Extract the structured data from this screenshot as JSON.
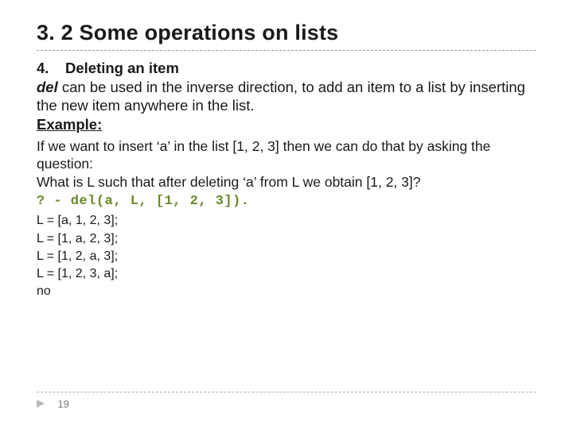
{
  "title": "3. 2 Some operations on lists",
  "item_number": "4.",
  "item_heading": "Deleting an item",
  "del_word": "del",
  "body_rest1": " can be used in the inverse direction, to add an item to a list by inserting the new item anywhere in the list.",
  "example_label": "Example:",
  "para2_line1": "If we want to insert ‘a’ in the list [1, 2, 3] then we can do that by asking the question:",
  "question": "What is L such that after deleting ‘a’ from L we obtain [1, 2, 3]?",
  "code": "? - del(a, L, [1, 2, 3]).",
  "results": [
    "L = [a, 1, 2, 3];",
    "L = [1, a, 2, 3];",
    "L = [1, 2, a, 3];",
    "L = [1, 2, 3, a];",
    "no"
  ],
  "page_number": "19"
}
